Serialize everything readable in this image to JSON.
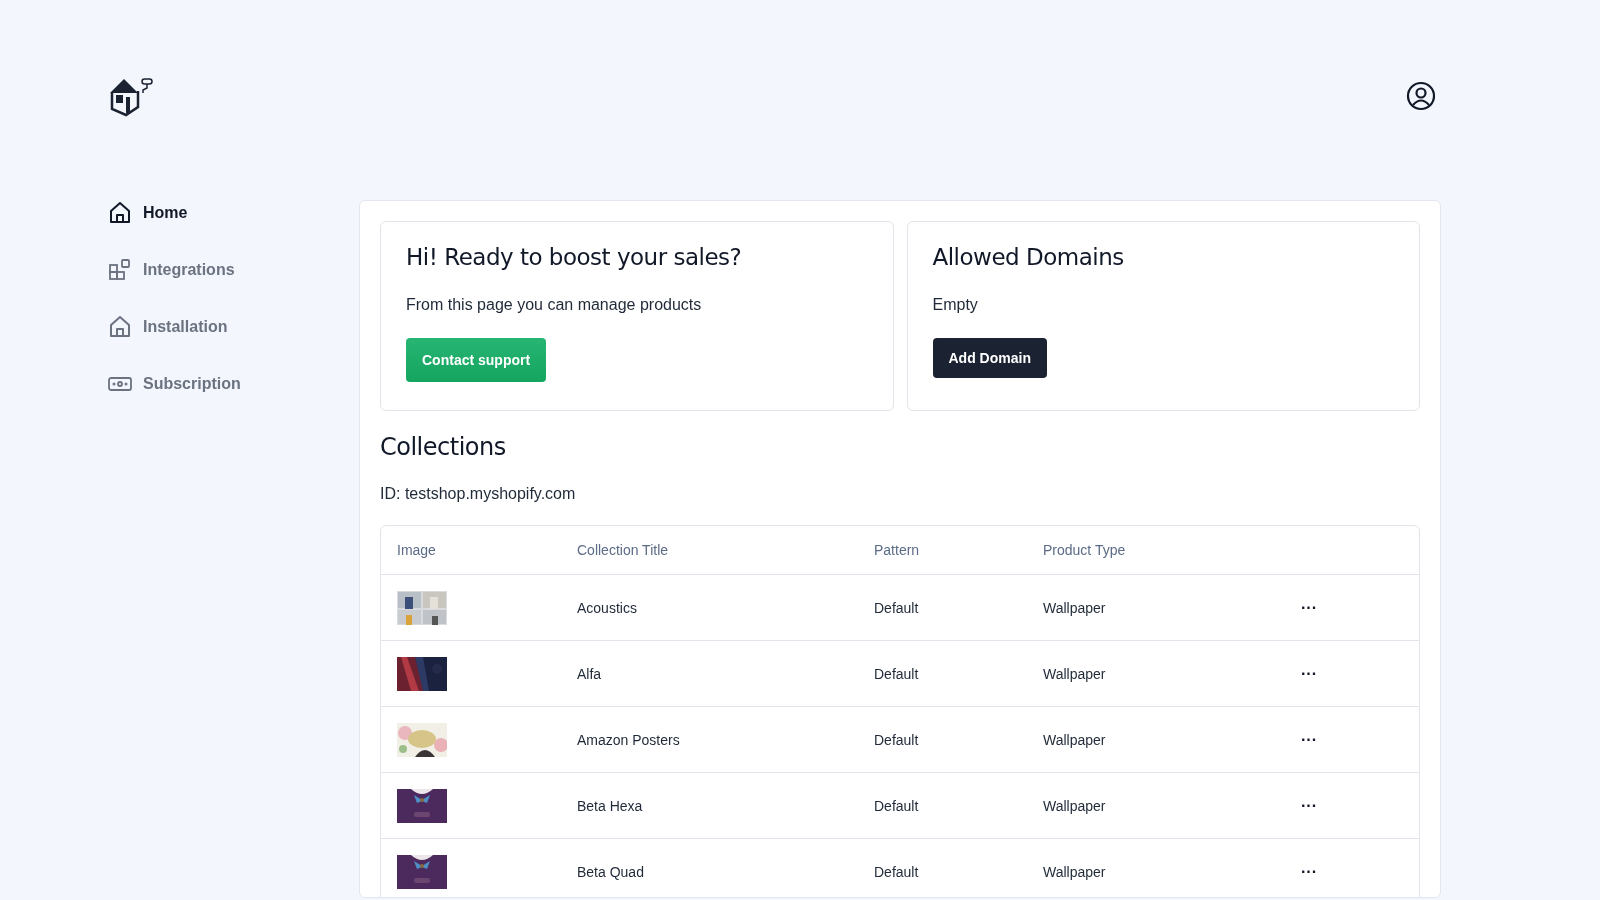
{
  "sidebar": {
    "items": [
      {
        "label": "Home",
        "selected": true
      },
      {
        "label": "Integrations",
        "selected": false
      },
      {
        "label": "Installation",
        "selected": false
      },
      {
        "label": "Subscription",
        "selected": false
      }
    ]
  },
  "cards": [
    {
      "title": "Hi! Ready to boost your sales?",
      "text": "From this page you can manage products",
      "button": {
        "label": "Contact support",
        "kind": "primary"
      }
    },
    {
      "title": "Allowed Domains",
      "text": "Empty",
      "button": {
        "label": "Add Domain",
        "kind": "dark"
      }
    }
  ],
  "collections": {
    "title": "Collections",
    "id_text": "ID: testshop.myshopify.com",
    "table": {
      "columns": [
        "Image",
        "Collection Title",
        "Pattern",
        "Product Type"
      ],
      "rows": [
        {
          "title": "Acoustics",
          "pattern": "Default",
          "product_type": "Wallpaper",
          "menu": "···"
        },
        {
          "title": "Alfa",
          "pattern": "Default",
          "product_type": "Wallpaper",
          "menu": "···"
        },
        {
          "title": "Amazon Posters",
          "pattern": "Default",
          "product_type": "Wallpaper",
          "menu": "···"
        },
        {
          "title": "Beta Hexa",
          "pattern": "Default",
          "product_type": "Wallpaper",
          "menu": "···"
        },
        {
          "title": "Beta Quad",
          "pattern": "Default",
          "product_type": "Wallpaper",
          "menu": "···"
        }
      ]
    }
  }
}
